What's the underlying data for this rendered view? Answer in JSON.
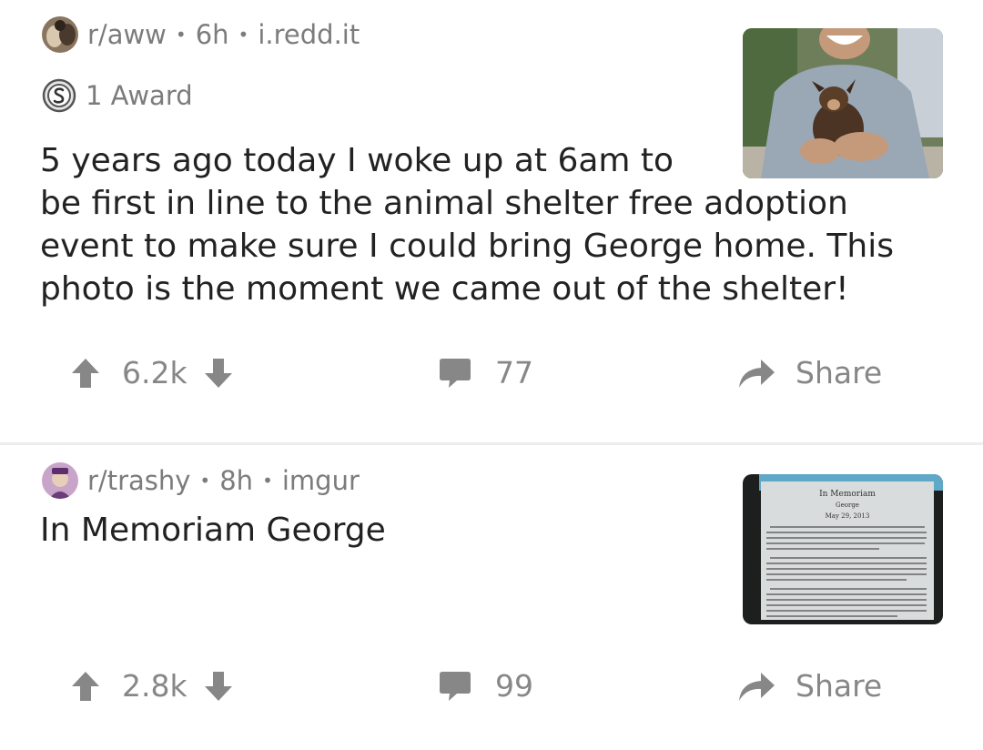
{
  "posts": [
    {
      "subreddit": "r/aww",
      "age": "6h",
      "domain": "i.redd.it",
      "award_text": "1 Award",
      "title_lines": [
        "5 years ago today I woke up at 6am to",
        "be first in line to the animal shelter free adoption",
        "event to make sure I could bring George home. This",
        "photo is the moment we came out of the shelter!"
      ],
      "votes": "6.2k",
      "comments": "77",
      "share_label": "Share"
    },
    {
      "subreddit": "r/trashy",
      "age": "8h",
      "domain": "imgur",
      "title_lines": [
        "In Memoriam George"
      ],
      "votes": "2.8k",
      "comments": "99",
      "share_label": "Share",
      "thumbnail_text": {
        "heading": "In Memoriam",
        "name": "George",
        "date": "May 29, 2013"
      }
    }
  ],
  "separator": "•",
  "colors": {
    "meta_gray": "#7c7c7c",
    "action_gray": "#878787",
    "title": "#222222"
  },
  "icons": [
    "upvote-arrow-icon",
    "downvote-arrow-icon",
    "comment-bubble-icon",
    "share-arrow-icon",
    "silver-award-icon"
  ]
}
